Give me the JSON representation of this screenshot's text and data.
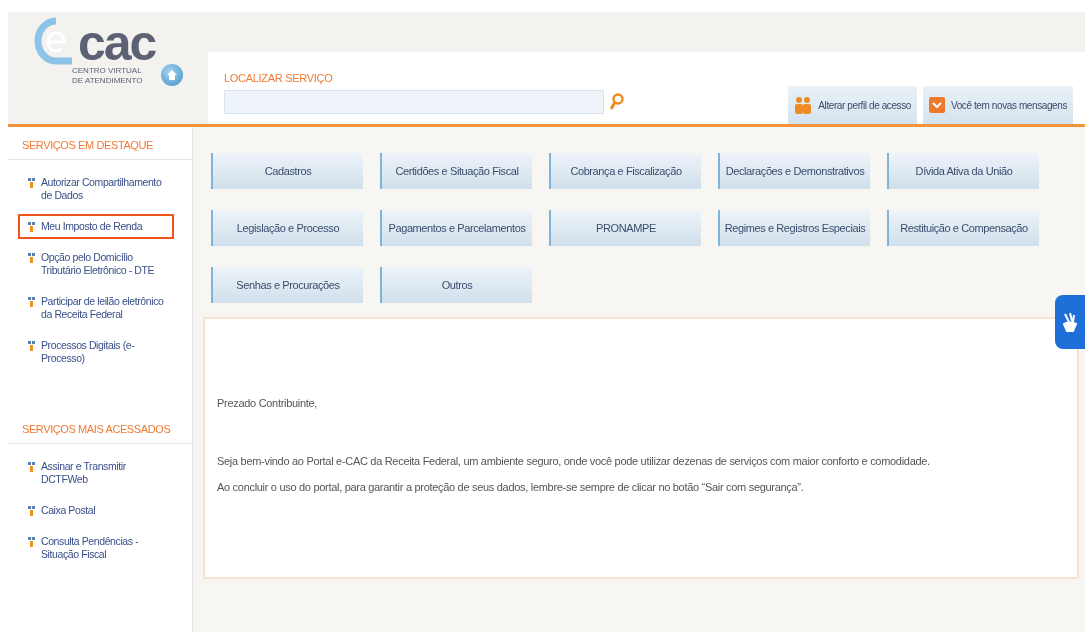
{
  "logo": {
    "mark": "cac",
    "subtitle": "CENTRO VIRTUAL DE ATENDIMENTO"
  },
  "search": {
    "label": "LOCALIZAR SERVIÇO"
  },
  "header_buttons": [
    {
      "label": "Alterar perfil de acesso",
      "kind": "profile"
    },
    {
      "label": "Você tem novas mensagens",
      "kind": "mail"
    }
  ],
  "sidebar": {
    "sections": [
      {
        "title": "SERVIÇOS EM DESTAQUE",
        "items": [
          {
            "label": "Autorizar Compartilhamento de Dados",
            "selected": false
          },
          {
            "label": "Meu Imposto de Renda",
            "selected": true
          },
          {
            "label": "Opção pelo Domicílio Tributário Eletrônico - DTE",
            "selected": false
          },
          {
            "label": "Participar de leilão eletrônico da Receita Federal",
            "selected": false
          },
          {
            "label": "Processos Digitais (e-Processo)",
            "selected": false
          }
        ]
      },
      {
        "title": "SERVIÇOS MAIS ACESSADOS",
        "items": [
          {
            "label": "Assinar e Transmitir DCTFWeb",
            "selected": false
          },
          {
            "label": "Caixa Postal",
            "selected": false
          },
          {
            "label": "Consulta Pendências - Situação Fiscal",
            "selected": false
          }
        ]
      }
    ]
  },
  "categories": [
    "Cadastros",
    "Certidões e Situação Fiscal",
    "Cobrança e Fiscalização",
    "Declarações e Demonstrativos",
    "Dívida Ativa da União",
    "Legislação e Processo",
    "Pagamentos e Parcelamentos",
    "PRONAMPE",
    "Regimes e Registros Especiais",
    "Restituição e Compensação",
    "Senhas e Procurações",
    "Outros"
  ],
  "message": {
    "greeting": "Prezado Contribuinte,",
    "paragraphs": [
      "Seja bem-vindo ao Portal e-CAC da Receita Federal, um ambiente seguro, onde você pode utilizar dezenas de serviços com maior conforto e comodidade.",
      "Ao concluir o uso do portal, para garantir a proteção de seus dados, lembre-se sempre de clicar no botão “Sair com segurança”."
    ]
  }
}
